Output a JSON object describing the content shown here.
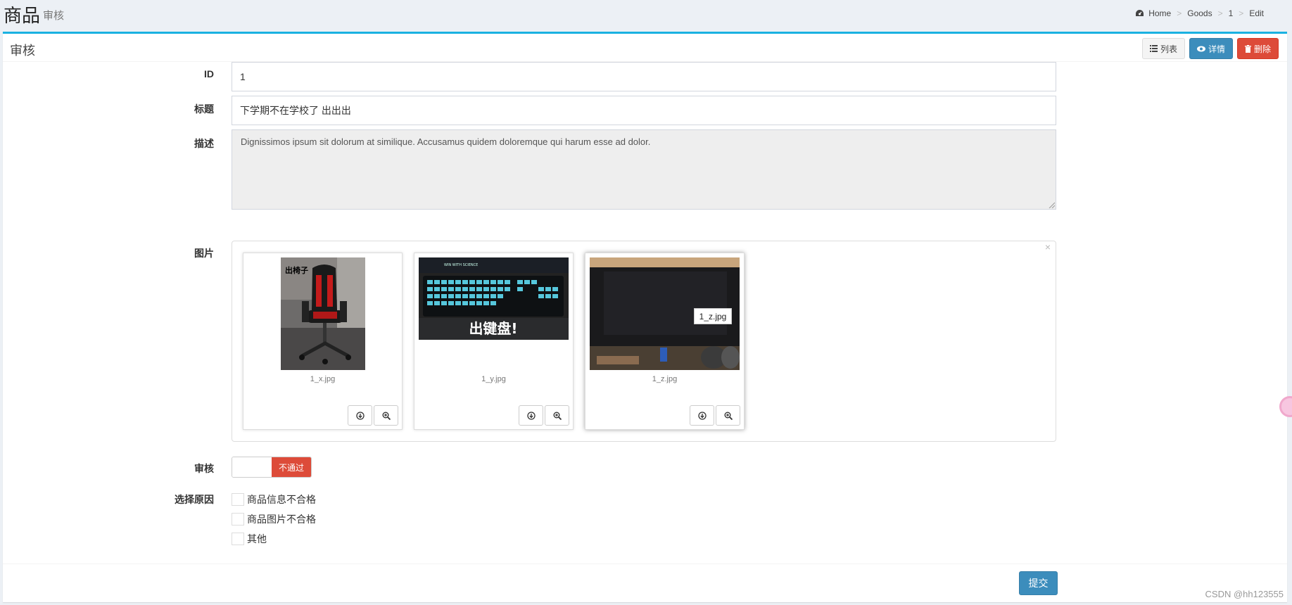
{
  "header": {
    "title": "商品",
    "subtitle": "审核"
  },
  "breadcrumb": {
    "items": [
      "Home",
      "Goods",
      "1",
      "Edit"
    ],
    "separator": ">"
  },
  "box": {
    "title": "审核",
    "tools": {
      "list_label": "列表",
      "detail_label": "详情",
      "delete_label": "删除"
    }
  },
  "form": {
    "id": {
      "label": "ID",
      "value": "1"
    },
    "title": {
      "label": "标题",
      "value": "下学期不在学校了 出出出"
    },
    "description": {
      "label": "描述",
      "value": "Dignissimos ipsum sit dolorum at similique. Accusamus quidem doloremque qui harum esse ad dolor."
    },
    "images": {
      "label": "图片",
      "files": [
        {
          "name": "1_x.jpg",
          "overlay_text": "出椅子"
        },
        {
          "name": "1_y.jpg",
          "overlay_text": "出键盘!",
          "banner_text": "WIN WITH SCIENCE"
        },
        {
          "name": "1_z.jpg",
          "tooltip": "1_z.jpg"
        }
      ],
      "close": "×"
    },
    "review": {
      "label": "审核",
      "state_label": "不通过"
    },
    "reasons": {
      "label": "选择原因",
      "options": [
        "商品信息不合格",
        "商品图片不合格",
        "其他"
      ]
    },
    "submit_label": "提交"
  },
  "watermark": "CSDN @hh123555",
  "colors": {
    "accent": "#1ab1e1",
    "info": "#3c8dbc",
    "danger": "#dd4b39"
  }
}
